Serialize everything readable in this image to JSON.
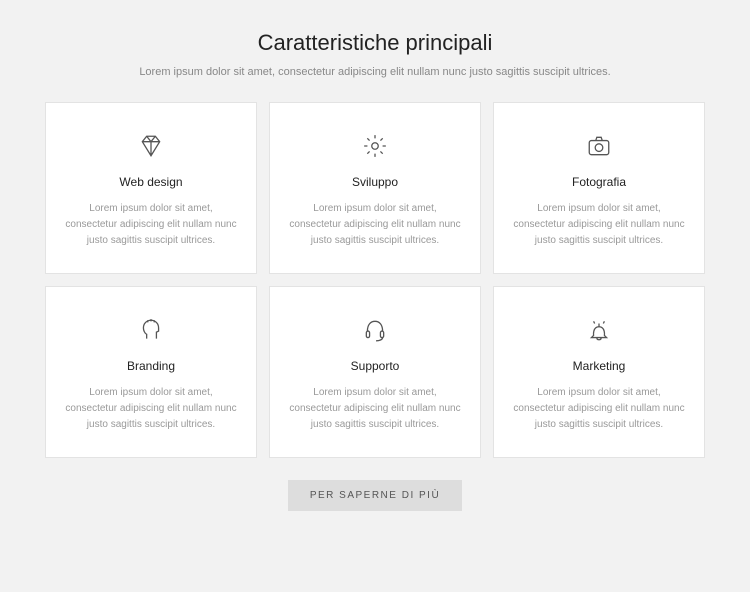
{
  "header": {
    "title": "Caratteristiche principali",
    "subtitle": "Lorem ipsum dolor sit amet, consectetur adipiscing elit nullam nunc justo sagittis suscipit ultrices."
  },
  "cards": [
    {
      "icon": "diamond",
      "title": "Web design",
      "text": "Lorem ipsum dolor sit amet, consectetur adipiscing elit nullam nunc justo sagittis suscipit ultrices."
    },
    {
      "icon": "gear",
      "title": "Sviluppo",
      "text": "Lorem ipsum dolor sit amet, consectetur adipiscing elit nullam nunc justo sagittis suscipit ultrices."
    },
    {
      "icon": "camera",
      "title": "Fotografia",
      "text": "Lorem ipsum dolor sit amet, consectetur adipiscing elit nullam nunc justo sagittis suscipit ultrices."
    },
    {
      "icon": "head",
      "title": "Branding",
      "text": "Lorem ipsum dolor sit amet, consectetur adipiscing elit nullam nunc justo sagittis suscipit ultrices."
    },
    {
      "icon": "headset",
      "title": "Supporto",
      "text": "Lorem ipsum dolor sit amet, consectetur adipiscing elit nullam nunc justo sagittis suscipit ultrices."
    },
    {
      "icon": "bell",
      "title": "Marketing",
      "text": "Lorem ipsum dolor sit amet, consectetur adipiscing elit nullam nunc justo sagittis suscipit ultrices."
    }
  ],
  "cta": {
    "label": "PER SAPERNE DI PIÙ"
  }
}
